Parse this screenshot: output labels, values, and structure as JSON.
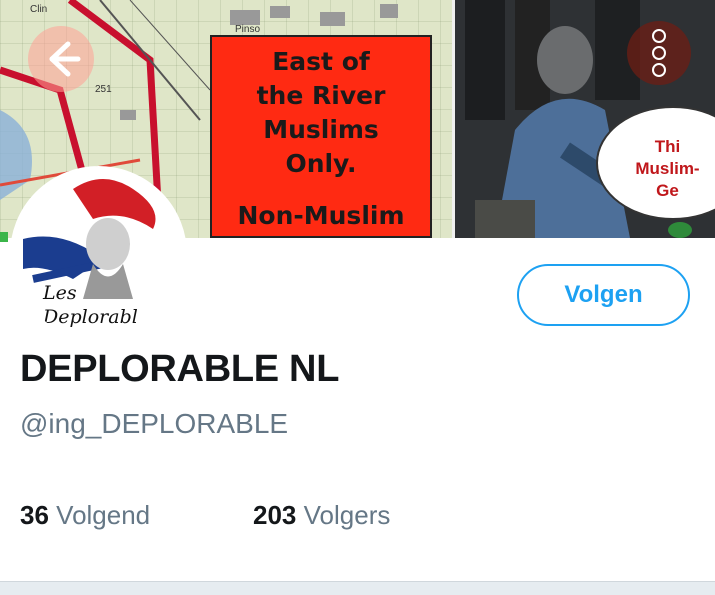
{
  "banner": {
    "sign_text": "East of\nthe River\nMuslims\nOnly.",
    "sign_text_2": "Non-Muslim",
    "speech_text": "Thi\nMuslim-\nGe",
    "map_label_1": "Clin",
    "map_label_2": "251",
    "map_label_3": "Pinso",
    "colors": {
      "sign_bg": "#ff2a12",
      "speech_text": "#c0171b"
    }
  },
  "header": {
    "back_icon": "back-arrow-icon",
    "menu_icon": "more-vertical-icon"
  },
  "avatar": {
    "text": "Les\nDeplorabl"
  },
  "profile": {
    "follow_label": "Volgen",
    "display_name": "DEPLORABLE NL",
    "handle": "@ing_DEPLORABLE",
    "following_count": "36",
    "following_label": "Volgend",
    "followers_count": "203",
    "followers_label": "Volgers"
  },
  "theme": {
    "accent": "#1da1f2",
    "text_secondary": "#657786"
  }
}
